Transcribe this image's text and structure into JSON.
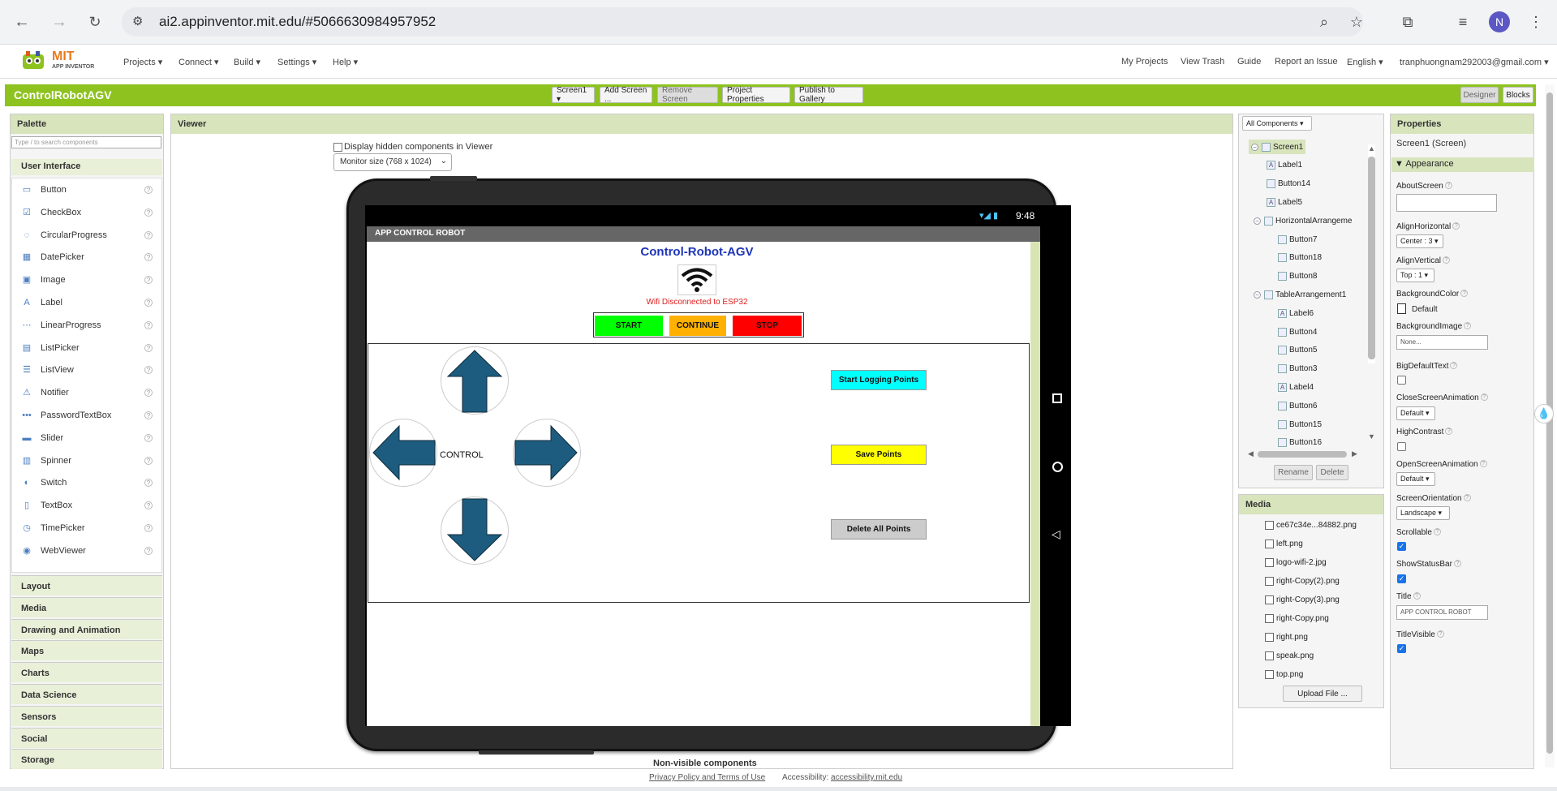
{
  "browser": {
    "url": "ai2.appinventor.mit.edu/#5066630984957952",
    "avatar_letter": "N",
    "icons": [
      "back-icon",
      "forward-icon",
      "reload-icon",
      "site-info-icon",
      "zoom-icon",
      "bookmark-star-icon",
      "extensions-icon",
      "media-icon",
      "menu-icon"
    ]
  },
  "nav": {
    "logo_line1": "MIT",
    "logo_line2": "APP INVENTOR",
    "menus": [
      "Projects ▾",
      "Connect ▾",
      "Build ▾",
      "Settings ▾",
      "Help ▾"
    ],
    "links": [
      "My Projects",
      "View Trash",
      "Guide",
      "Report an Issue",
      "English ▾",
      "tranphuongnam292003@gmail.com ▾"
    ]
  },
  "toolbar": {
    "project_name": "ControlRobotAGV",
    "screen_select": "Screen1 ▾",
    "add_screen": "Add Screen ...",
    "remove_screen": "Remove Screen",
    "project_properties": "Project Properties",
    "publish": "Publish to Gallery",
    "designer": "Designer",
    "blocks": "Blocks"
  },
  "palette": {
    "title": "Palette",
    "search_placeholder": "Type / to search components",
    "section": "User Interface",
    "items": [
      {
        "label": "Button",
        "icon": "button-icon"
      },
      {
        "label": "CheckBox",
        "icon": "checkbox-icon"
      },
      {
        "label": "CircularProgress",
        "icon": "circular-progress-icon"
      },
      {
        "label": "DatePicker",
        "icon": "datepicker-icon"
      },
      {
        "label": "Image",
        "icon": "image-icon"
      },
      {
        "label": "Label",
        "icon": "label-icon"
      },
      {
        "label": "LinearProgress",
        "icon": "linear-progress-icon"
      },
      {
        "label": "ListPicker",
        "icon": "listpicker-icon"
      },
      {
        "label": "ListView",
        "icon": "listview-icon"
      },
      {
        "label": "Notifier",
        "icon": "notifier-icon"
      },
      {
        "label": "PasswordTextBox",
        "icon": "password-icon"
      },
      {
        "label": "Slider",
        "icon": "slider-icon"
      },
      {
        "label": "Spinner",
        "icon": "spinner-icon"
      },
      {
        "label": "Switch",
        "icon": "switch-icon"
      },
      {
        "label": "TextBox",
        "icon": "textbox-icon"
      },
      {
        "label": "TimePicker",
        "icon": "timepicker-icon"
      },
      {
        "label": "WebViewer",
        "icon": "webviewer-icon"
      }
    ],
    "categories": [
      "Layout",
      "Media",
      "Drawing and Animation",
      "Maps",
      "Charts",
      "Data Science",
      "Sensors",
      "Social",
      "Storage"
    ]
  },
  "viewer": {
    "title": "Viewer",
    "hidden_checkbox": "Display hidden components in Viewer",
    "monitor": "Monitor size (768 x 1024)",
    "clock": "9:48",
    "app_title_bar": "APP CONTROL ROBOT",
    "app_heading": "Control-Robot-AGV",
    "wifi_status": "Wifi Disconnected to ESP32",
    "start": "START",
    "continue": "CONTINUE",
    "stop": "STOP",
    "control_label": "CONTROL",
    "start_logging": "Start Logging Points",
    "save_points": "Save Points",
    "delete_points": "Delete All Points",
    "non_visible": "Non-visible components",
    "footer_privacy": "Privacy Policy and Terms of Use",
    "footer_accessibility": "Accessibility:",
    "footer_accessibility_link": "accessibility.mit.edu",
    "colors": {
      "start": "#00ff00",
      "continue": "#ffb000",
      "stop": "#ff0000",
      "logging": "#00ffff",
      "save": "#ffff00",
      "delete": "#cccccc",
      "arrow": "#1d5c7f",
      "heading": "#1e35b8",
      "wifi_text": "#e21c1c"
    }
  },
  "components": {
    "dropdown": "All Components ▾",
    "tree": [
      {
        "label": "Screen1",
        "toggle": "⊟",
        "level": 0
      },
      {
        "label": "Label1",
        "level": 1
      },
      {
        "label": "Button14",
        "level": 1
      },
      {
        "label": "Label5",
        "level": 1
      },
      {
        "label": "HorizontalArrangeme",
        "toggle": "⊟",
        "level": 1
      },
      {
        "label": "Button7",
        "level": 2
      },
      {
        "label": "Button18",
        "level": 2
      },
      {
        "label": "Button8",
        "level": 2
      },
      {
        "label": "TableArrangement1",
        "toggle": "⊟",
        "level": 1
      },
      {
        "label": "Label6",
        "level": 2
      },
      {
        "label": "Button4",
        "level": 2
      },
      {
        "label": "Button5",
        "level": 2
      },
      {
        "label": "Button3",
        "level": 2
      },
      {
        "label": "Label4",
        "level": 2
      },
      {
        "label": "Button6",
        "level": 2
      },
      {
        "label": "Button15",
        "level": 2
      },
      {
        "label": "Button16",
        "level": 2
      }
    ],
    "rename": "Rename",
    "delete": "Delete"
  },
  "media": {
    "title": "Media",
    "files": [
      "ce67c34e...84882.png",
      "left.png",
      "logo-wifi-2.jpg",
      "right-Copy(2).png",
      "right-Copy(3).png",
      "right-Copy.png",
      "right.png",
      "speak.png",
      "top.png"
    ],
    "upload": "Upload File ..."
  },
  "properties": {
    "title": "Properties",
    "component": "Screen1 (Screen)",
    "section": "Appearance",
    "about_screen": "AboutScreen",
    "align_horizontal": "AlignHorizontal",
    "align_horizontal_value": "Center : 3 ▾",
    "align_vertical": "AlignVertical",
    "align_vertical_value": "Top : 1 ▾",
    "background_color": "BackgroundColor",
    "background_color_value": "Default",
    "background_image": "BackgroundImage",
    "background_image_value": "None...",
    "big_default_text": "BigDefaultText",
    "close_anim": "CloseScreenAnimation",
    "close_anim_value": "Default ▾",
    "high_contrast": "HighContrast",
    "open_anim": "OpenScreenAnimation",
    "open_anim_value": "Default ▾",
    "orientation": "ScreenOrientation",
    "orientation_value": "Landscape ▾",
    "scrollable": "Scrollable",
    "show_status_bar": "ShowStatusBar",
    "title_label": "Title",
    "title_value": "APP CONTROL ROBOT",
    "title_visible": "TitleVisible"
  }
}
